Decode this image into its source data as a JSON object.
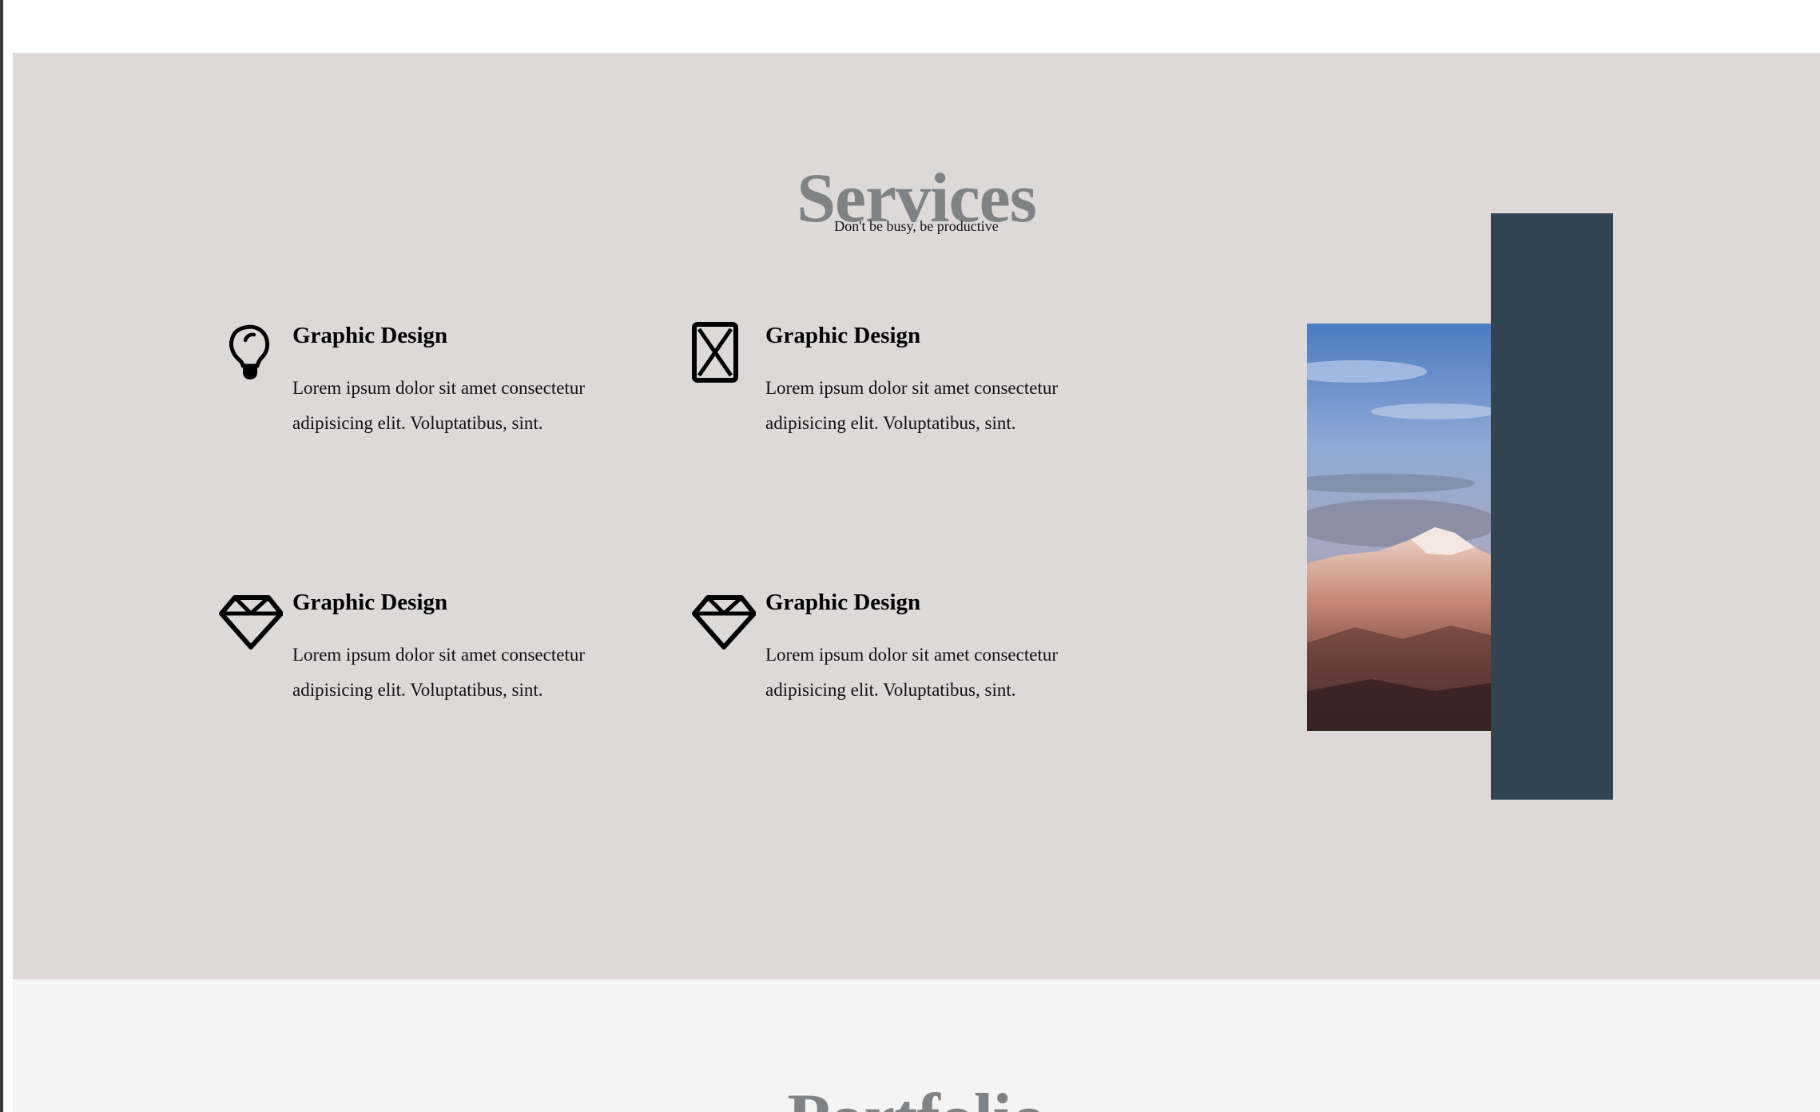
{
  "services": {
    "title": "Services",
    "subtitle": "Don't be busy, be productive",
    "items": [
      {
        "icon": "lightbulb-icon",
        "title": "Graphic Design",
        "text": "Lorem ipsum dolor sit amet consectetur adipisicing elit. Voluptatibus, sint."
      },
      {
        "icon": "hourglass-icon",
        "title": "Graphic Design",
        "text": "Lorem ipsum dolor sit amet consectetur adipisicing elit. Voluptatibus, sint."
      },
      {
        "icon": "diamond-icon",
        "title": "Graphic Design",
        "text": "Lorem ipsum dolor sit amet consectetur adipisicing elit. Voluptatibus, sint."
      },
      {
        "icon": "diamond-icon",
        "title": "Graphic Design",
        "text": "Lorem ipsum dolor sit amet consectetur adipisicing elit. Voluptatibus, sint."
      }
    ],
    "image": "mountain-photo",
    "colors": {
      "background": "#ddd9d9",
      "title": "#808385",
      "panel": "#324452"
    }
  },
  "portfolio": {
    "title": "Portfolio",
    "colors": {
      "background": "#f4f4f4"
    }
  }
}
